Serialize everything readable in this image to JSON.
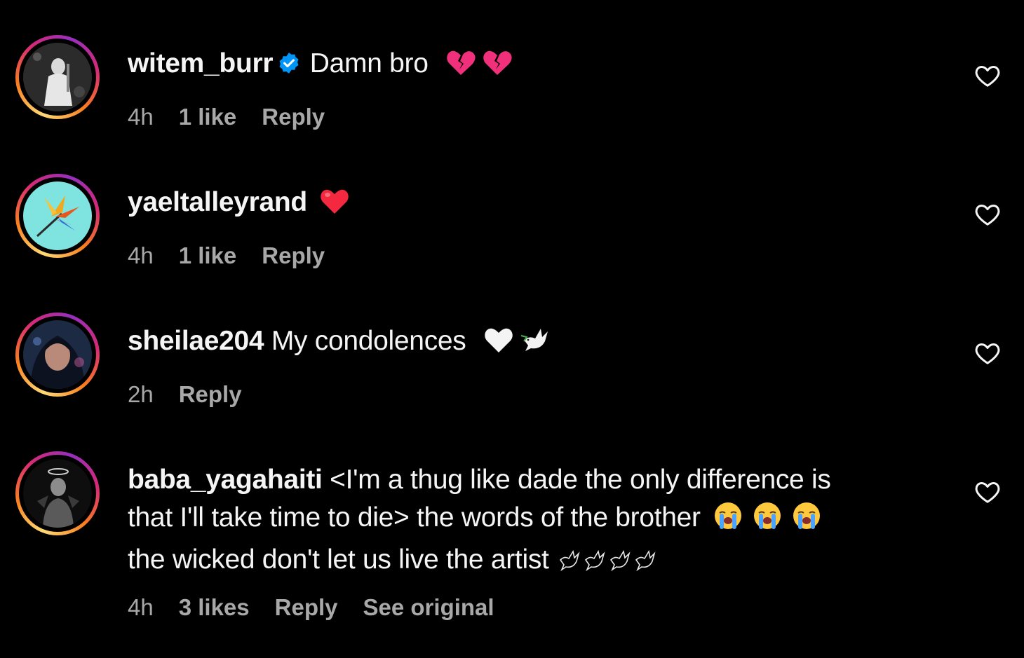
{
  "comments": [
    {
      "username": "witem_burr",
      "verified": true,
      "text": "Damn bro",
      "emojis": [
        "broken-heart",
        "broken-heart"
      ],
      "time": "4h",
      "likes": "1 like",
      "reply": "Reply"
    },
    {
      "username": "yaeltalleyrand",
      "verified": false,
      "text": "",
      "emojis": [
        "red-heart"
      ],
      "time": "4h",
      "likes": "1 like",
      "reply": "Reply"
    },
    {
      "username": "sheilae204",
      "verified": false,
      "text": "My condolences",
      "emojis": [
        "white-heart",
        "dove"
      ],
      "time": "2h",
      "reply": "Reply"
    },
    {
      "username": "baba_yagahaiti",
      "verified": false,
      "text_line1": "<I'm a thug like dade the only difference is",
      "text_line2": "that I'll take time to die> the words of the brother",
      "text_line3": "the wicked don't let us live the artist",
      "emojis_line2": [
        "crying-face",
        "crying-face",
        "crying-face"
      ],
      "emojis_line3": [
        "dove",
        "dove",
        "dove",
        "dove"
      ],
      "time": "4h",
      "likes": "3 likes",
      "reply": "Reply",
      "see_original": "See original"
    }
  ],
  "colors": {
    "background": "#000000",
    "text": "#f5f5f5",
    "meta": "#a8a8a8",
    "verified": "#0095f6",
    "broken_heart": "#f0307a",
    "red_heart": "#f4283e"
  }
}
